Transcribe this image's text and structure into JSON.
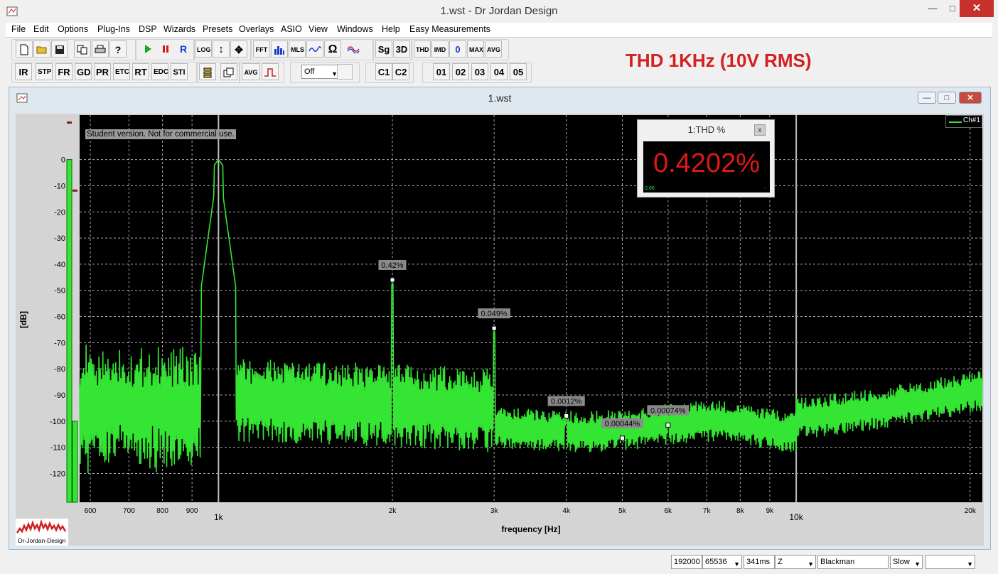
{
  "window": {
    "title": "1.wst - Dr Jordan Design",
    "minimize": "—",
    "maximize": "□",
    "close": "✕"
  },
  "menu": [
    "File",
    "Edit",
    "Options",
    "Plug-Ins",
    "DSP",
    "Wizards",
    "Presets",
    "Overlays",
    "ASIO",
    "View",
    "Windows",
    "Help",
    "Easy Measurements"
  ],
  "toolbar": {
    "row1": [
      "new-icon",
      "open-icon",
      "save-icon",
      "copy-icon",
      "print-icon",
      "help-icon",
      "play-icon",
      "pause-icon",
      "R",
      "LOG",
      "vertical-move-icon",
      "move-icon",
      "FFT",
      "bars-icon",
      "MLS",
      "wave-icon",
      "Ω",
      "sweep-icon",
      "Sg",
      "3D",
      "THD",
      "IMD",
      "0",
      "MAX",
      "AVG"
    ],
    "row2": [
      "IR",
      "STP",
      "FR",
      "GD",
      "PR",
      "ETC",
      "RT",
      "EDC",
      "STI",
      "marker-icon",
      "window-icon",
      "AVG",
      "step-icon"
    ],
    "dropdown_value": "Off",
    "channels": [
      "C1",
      "C2"
    ],
    "presets": [
      "01",
      "02",
      "03",
      "04",
      "05"
    ],
    "colors": {
      "play": "#18a818",
      "pause": "#d01818",
      "accent_blue": "#1a3fd0"
    }
  },
  "headline": "THD 1KHz (10V RMS)",
  "mdi": {
    "title": "1.wst"
  },
  "student_notice": "Student version. Not for commercial use.",
  "thd_panel": {
    "title": "1:THD %",
    "close": "x",
    "value": "0.4202%",
    "value_color": "#e01818",
    "min_label": "0.00",
    "max_label": "--"
  },
  "legend": {
    "label": "Ch#1",
    "color": "#34e534"
  },
  "logo": {
    "text": "Dr-Jordan-Design"
  },
  "chart_data": {
    "type": "line",
    "xlabel": "frequency [Hz]",
    "ylabel": "[dB]",
    "x_scale": "log",
    "xlim": [
      575,
      21000
    ],
    "ylim": [
      -131,
      17
    ],
    "grid": true,
    "background": "#000000",
    "line_color": "#34e534",
    "x_ticks": [
      {
        "value": 600,
        "label": "600",
        "major": false
      },
      {
        "value": 700,
        "label": "700",
        "major": false
      },
      {
        "value": 800,
        "label": "800",
        "major": false
      },
      {
        "value": 900,
        "label": "900",
        "major": false
      },
      {
        "value": 1000,
        "label": "1k",
        "major": true
      },
      {
        "value": 2000,
        "label": "2k",
        "major": false
      },
      {
        "value": 3000,
        "label": "3k",
        "major": false
      },
      {
        "value": 4000,
        "label": "4k",
        "major": false
      },
      {
        "value": 5000,
        "label": "5k",
        "major": false
      },
      {
        "value": 6000,
        "label": "6k",
        "major": false
      },
      {
        "value": 7000,
        "label": "7k",
        "major": false
      },
      {
        "value": 8000,
        "label": "8k",
        "major": false
      },
      {
        "value": 9000,
        "label": "9k",
        "major": false
      },
      {
        "value": 10000,
        "label": "10k",
        "major": true
      },
      {
        "value": 20000,
        "label": "20k",
        "major": false
      }
    ],
    "y_ticks": [
      {
        "value": 0,
        "label": "0"
      },
      {
        "value": -10,
        "label": "-10"
      },
      {
        "value": -20,
        "label": "-20"
      },
      {
        "value": -30,
        "label": "-30"
      },
      {
        "value": -40,
        "label": "-40"
      },
      {
        "value": -50,
        "label": "-50"
      },
      {
        "value": -60,
        "label": "-60"
      },
      {
        "value": -70,
        "label": "-70"
      },
      {
        "value": -80,
        "label": "-80"
      },
      {
        "value": -90,
        "label": "-90"
      },
      {
        "value": -100,
        "label": "-100"
      },
      {
        "value": -110,
        "label": "-110"
      },
      {
        "value": -120,
        "label": "-120"
      }
    ],
    "harmonic_markers": [
      {
        "freq": 2000,
        "db": -46,
        "label": "0.42%"
      },
      {
        "freq": 3000,
        "db": -64.5,
        "label": "0.049%"
      },
      {
        "freq": 4000,
        "db": -98,
        "label": "0.0012%"
      },
      {
        "freq": 5000,
        "db": -106.5,
        "label": "0.00044%"
      },
      {
        "freq": 6000,
        "db": -101.5,
        "label": "0.00074%"
      }
    ],
    "level_meter": {
      "level_db": -100,
      "peak_db": -12
    }
  },
  "status": {
    "sample_rate": "192000",
    "fft_size": "65536",
    "duration": "341ms",
    "mode": "Z",
    "window_fn": "Blackman",
    "speed": "Slow",
    "extra": ""
  }
}
